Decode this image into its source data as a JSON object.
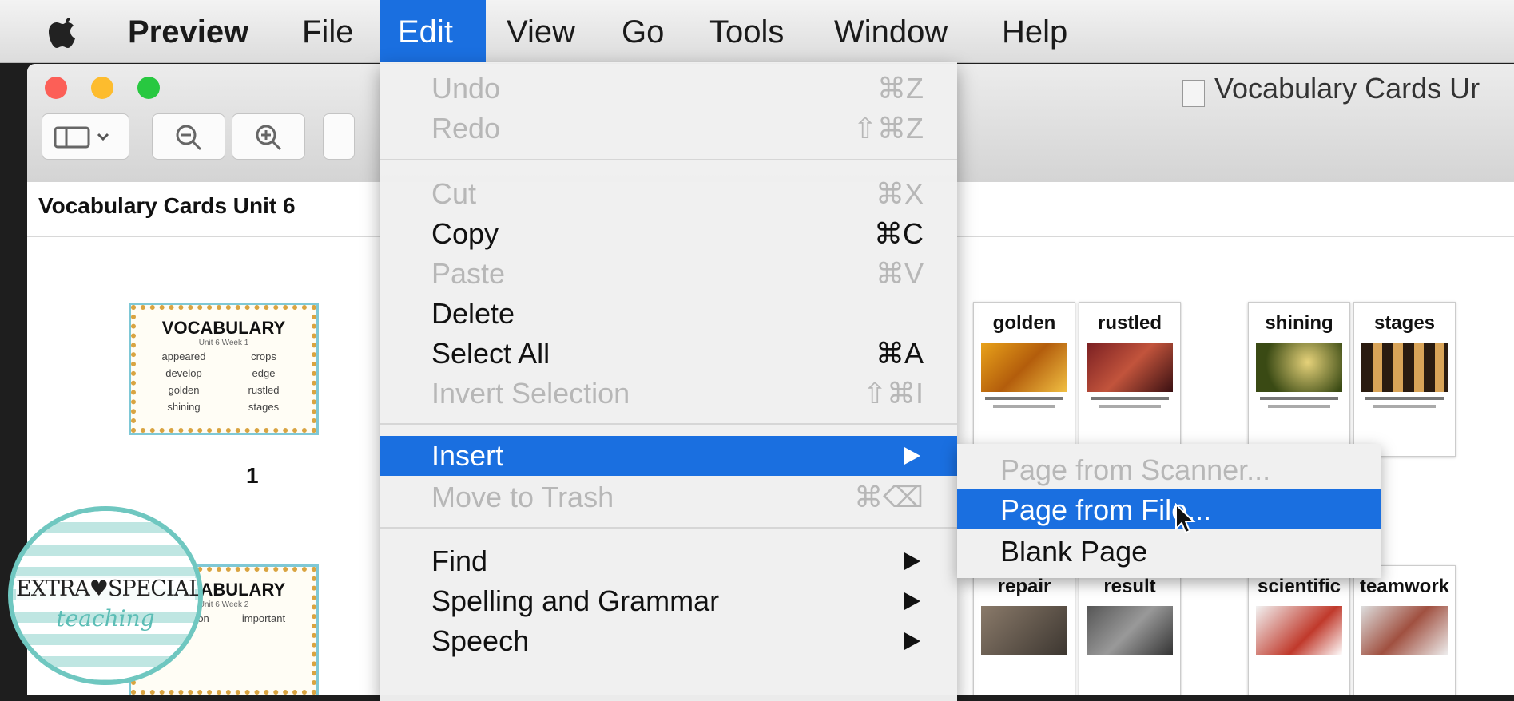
{
  "menubar": {
    "app": "Preview",
    "items": [
      "File",
      "Edit",
      "View",
      "Go",
      "Tools",
      "Window",
      "Help"
    ]
  },
  "window": {
    "title": "Vocabulary Cards Ur",
    "sidebar_title": "Vocabulary Cards Unit 6",
    "page_label": "1"
  },
  "thumbnails": {
    "cover1": {
      "title": "VOCABULARY",
      "subtitle": "Unit 6 Week 1",
      "words": [
        "appeared",
        "crops",
        "develop",
        "edge",
        "golden",
        "rustled",
        "shining",
        "stages"
      ]
    },
    "cover2": {
      "title": "VOCABULARY",
      "subtitle": "Unit 6 Week 2",
      "words": [
        "exploration",
        "important"
      ]
    },
    "row1": [
      "golden",
      "rustled",
      "shining",
      "stages"
    ],
    "row2": [
      "repair",
      "result",
      "scientific",
      "teamwork"
    ]
  },
  "edit_menu": {
    "undo": "Undo",
    "undo_sc": "⌘Z",
    "redo": "Redo",
    "redo_sc": "⇧⌘Z",
    "cut": "Cut",
    "cut_sc": "⌘X",
    "copy": "Copy",
    "copy_sc": "⌘C",
    "paste": "Paste",
    "paste_sc": "⌘V",
    "delete": "Delete",
    "select_all": "Select All",
    "select_all_sc": "⌘A",
    "invert_selection": "Invert Selection",
    "invert_selection_sc": "⇧⌘I",
    "insert": "Insert",
    "move_to_trash": "Move to Trash",
    "move_to_trash_sc": "⌘⌫",
    "find": "Find",
    "spelling": "Spelling and Grammar",
    "speech": "Speech"
  },
  "insert_submenu": {
    "from_scanner": "Page from Scanner...",
    "from_file": "Page from File...",
    "blank": "Blank Page"
  },
  "watermark": {
    "line1": "EXTRA♥SPECIAL",
    "line2": "teaching"
  },
  "colors": {
    "highlight": "#1a6fe0",
    "close": "#fc5f57",
    "minimize": "#fdbc2e",
    "zoom": "#28c840"
  }
}
